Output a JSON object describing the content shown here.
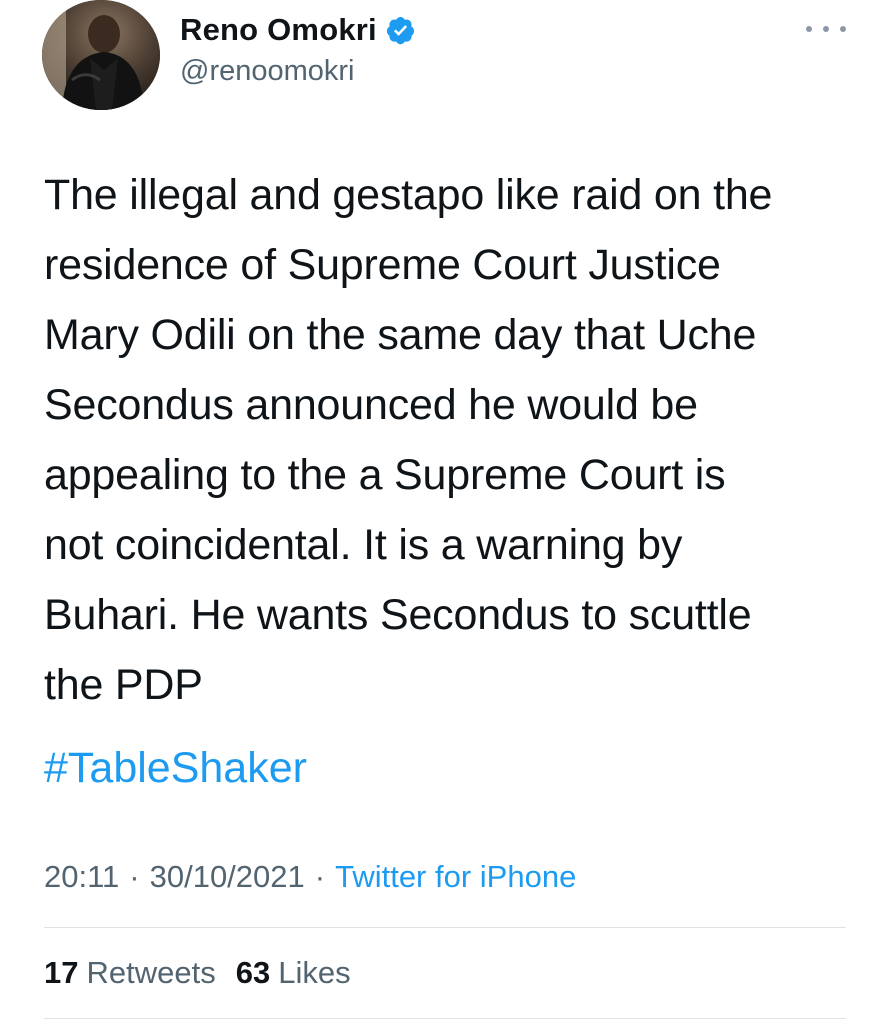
{
  "author": {
    "display_name": "Reno Omokri",
    "handle": "@renoomokri",
    "avatar_icon": "profile-photo",
    "verified_icon": "verified-badge-icon"
  },
  "menu": {
    "icon": "more-options-icon"
  },
  "tweet": {
    "lines": [
      "The illegal and gestapo like raid on the",
      "residence of Supreme Court Justice",
      "Mary Odili on the same day that Uche",
      "Secondus announced he would be",
      "appealing to the a Supreme Court is",
      "not coincidental. It is a warning by",
      "Buhari. He wants Secondus to scuttle",
      "the PDP"
    ],
    "hashtag": "#TableShaker"
  },
  "meta": {
    "time": "20:11",
    "separator": "·",
    "date": "30/10/2021",
    "source": "Twitter for iPhone"
  },
  "stats": {
    "retweets_count": "17",
    "retweets_label": "Retweets",
    "likes_count": "63",
    "likes_label": "Likes"
  },
  "colors": {
    "text": "#0f1419",
    "secondary": "#536471",
    "link": "#1d9bf0",
    "verified": "#1d9bf0",
    "divider": "#dfe3e6"
  }
}
